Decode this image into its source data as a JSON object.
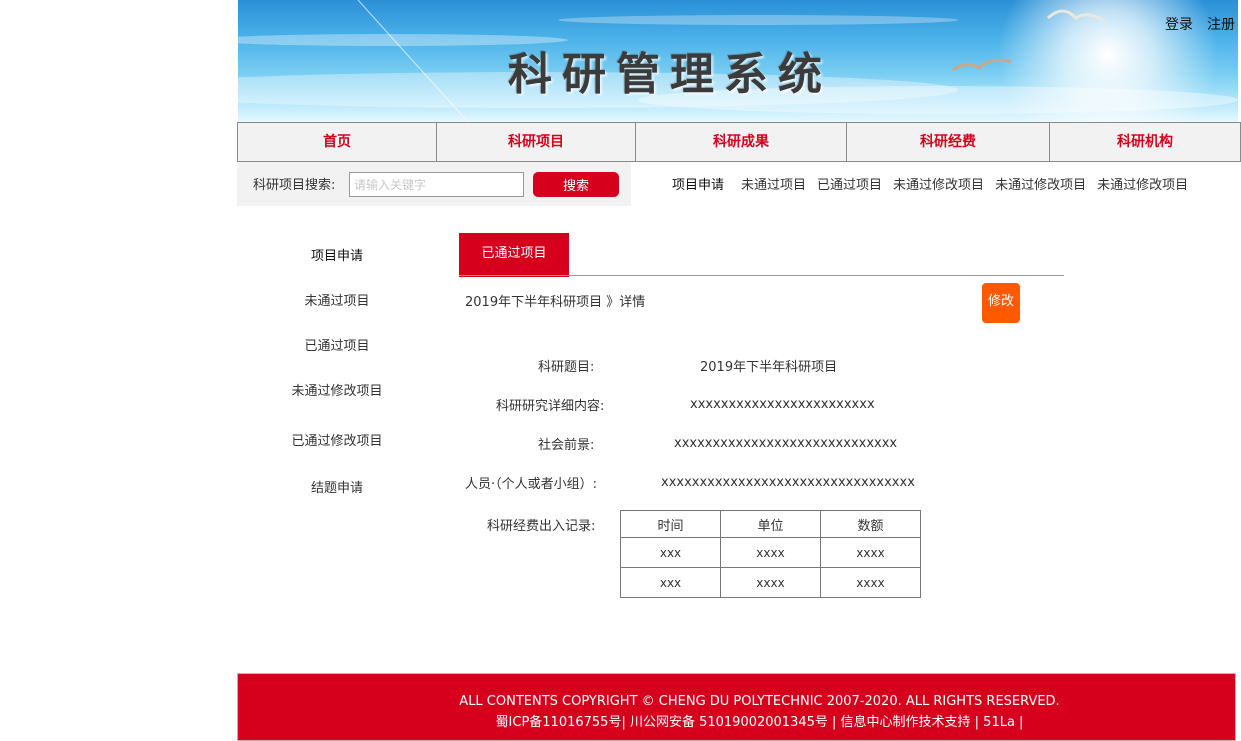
{
  "header": {
    "title": "科研管理系统",
    "login": "登录",
    "register": "注册"
  },
  "nav": {
    "items": [
      {
        "label": "首页"
      },
      {
        "label": "科研项目"
      },
      {
        "label": "科研成果"
      },
      {
        "label": "科研经费"
      },
      {
        "label": "科研机构"
      }
    ]
  },
  "search": {
    "label": "科研项目搜索:",
    "placeholder": "请输入关键字",
    "button": "搜索"
  },
  "sub_links": [
    "项目申请",
    "未通过项目",
    "已通过项目",
    "未通过修改项目",
    "未通过修改项目",
    "未通过修改项目"
  ],
  "sidebar": {
    "items": [
      "项目申请",
      "未通过项目",
      "已通过项目",
      "未通过修改项目",
      "已通过修改项目",
      "结题申请"
    ]
  },
  "main": {
    "tab": "已通过项目",
    "breadcrumb": "2019年下半年科研项目 》详情",
    "edit_button": "修改",
    "fields": {
      "title_label": "科研题目:",
      "title_value": "2019年下半年科研项目",
      "content_label": "科研研究详细内容:",
      "content_value": "xxxxxxxxxxxxxxxxxxxxxxxx",
      "prospect_label": "社会前景:",
      "prospect_value": "xxxxxxxxxxxxxxxxxxxxxxxxxxxxx",
      "people_label": "人员·（个人或者小组）:",
      "people_value": "xxxxxxxxxxxxxxxxxxxxxxxxxxxxxxxxx",
      "funds_label": "科研经费出入记录:"
    },
    "table": {
      "headers": [
        "时间",
        "单位",
        "数额"
      ],
      "rows": [
        [
          "xxx",
          "xxxx",
          "xxxx"
        ],
        [
          "xxx",
          "xxxx",
          "xxxx"
        ]
      ]
    }
  },
  "footer": {
    "line1": "ALL CONTENTS COPYRIGHT © CHENG DU POLYTECHNIC 2007-2020. ALL RIGHTS RESERVED.",
    "line2": "蜀ICP备11016755号| 川公网安备 51019002001345号    |    信息中心制作技术支持    |    51La |"
  },
  "colors": {
    "accent": "#d6001c",
    "edit": "#ff5a00"
  }
}
